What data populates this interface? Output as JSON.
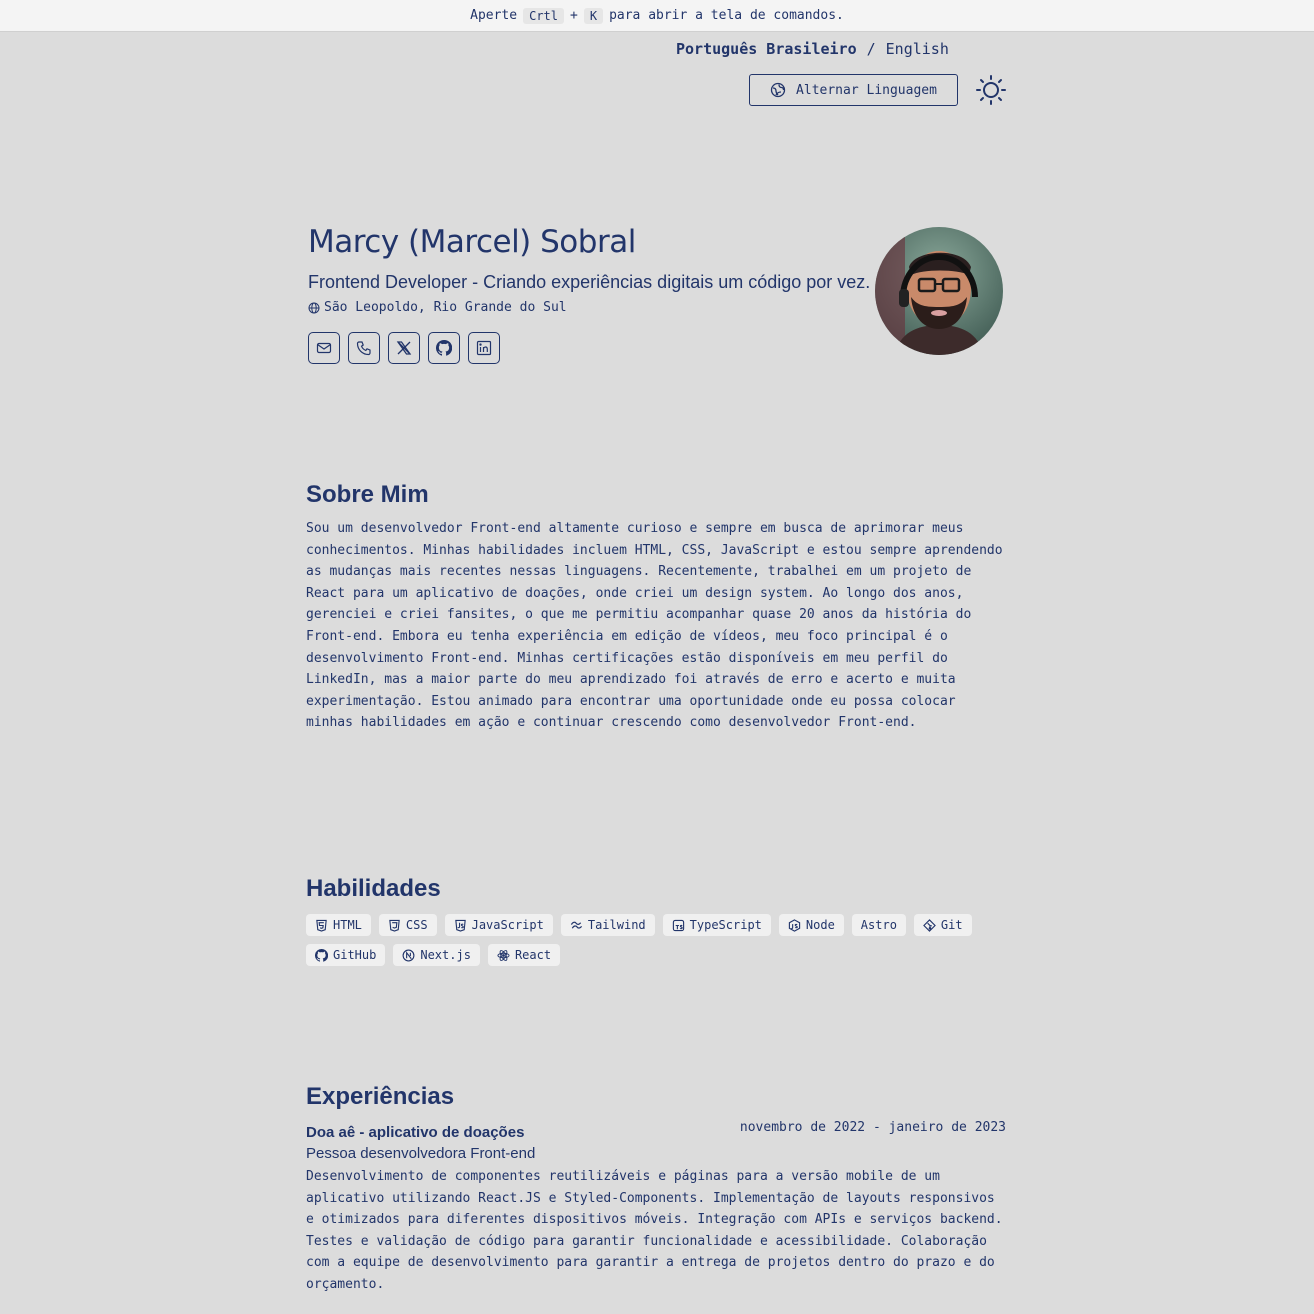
{
  "topbar": {
    "prefix": "Aperte",
    "key1": "Crtl",
    "plus": "+",
    "key2": "K",
    "suffix": "para abrir a tela de comandos."
  },
  "language": {
    "active": "Português Brasileiro",
    "separator": "/",
    "other": "English",
    "toggle_label": "Alternar Linguagem"
  },
  "profile": {
    "name": "Marcy (Marcel) Sobral",
    "subtitle": "Frontend Developer - Criando experiências digitais um código por vez.",
    "location": "São Leopoldo, Rio Grande do Sul"
  },
  "socials": [
    "mail-icon",
    "phone-icon",
    "x-icon",
    "github-icon",
    "linkedin-icon"
  ],
  "about": {
    "title": "Sobre Mim",
    "text": "Sou um desenvolvedor Front-end altamente curioso e sempre em busca de aprimorar meus conhecimentos. Minhas habilidades incluem HTML, CSS, JavaScript e estou sempre aprendendo as mudanças mais recentes nessas linguagens. Recentemente, trabalhei em um projeto de React para um aplicativo de doações, onde criei um design system. Ao longo dos anos, gerenciei e criei fansites, o que me permitiu acompanhar quase 20 anos da história do Front-end. Embora eu tenha experiência em edição de vídeos, meu foco principal é o desenvolvimento Front-end. Minhas certificações estão disponíveis em meu perfil do LinkedIn, mas a maior parte do meu aprendizado foi através de erro e acerto e muita experimentação. Estou animado para encontrar uma oportunidade onde eu possa colocar minhas habilidades em ação e continuar crescendo como desenvolvedor Front-end."
  },
  "skills": {
    "title": "Habilidades",
    "items": [
      {
        "label": "HTML",
        "icon": "html5-icon"
      },
      {
        "label": "CSS",
        "icon": "css3-icon"
      },
      {
        "label": "JavaScript",
        "icon": "javascript-icon"
      },
      {
        "label": "Tailwind",
        "icon": "tailwind-icon"
      },
      {
        "label": "TypeScript",
        "icon": "typescript-icon"
      },
      {
        "label": "Node",
        "icon": "nodejs-icon"
      },
      {
        "label": "Astro",
        "icon": ""
      },
      {
        "label": "Git",
        "icon": "git-icon"
      },
      {
        "label": "GitHub",
        "icon": "github-icon"
      },
      {
        "label": "Next.js",
        "icon": "nextjs-icon"
      },
      {
        "label": "React",
        "icon": "react-icon"
      }
    ]
  },
  "experience": {
    "title": "Experiências",
    "items": [
      {
        "company": "Doa aê - aplicativo de doações",
        "dates": "novembro de 2022 - janeiro de 2023",
        "role": "Pessoa desenvolvedora Front-end",
        "description": "Desenvolvimento de componentes reutilizáveis e páginas para a versão mobile de um aplicativo utilizando React.JS e Styled-Components. Implementação de layouts responsivos e otimizados para diferentes dispositivos móveis. Integração com APIs e serviços backend. Testes e validação de código para garantir funcionalidade e acessibilidade. Colaboração com a equipe de desenvolvimento para garantir a entrega de projetos dentro do prazo e do orçamento."
      }
    ]
  }
}
